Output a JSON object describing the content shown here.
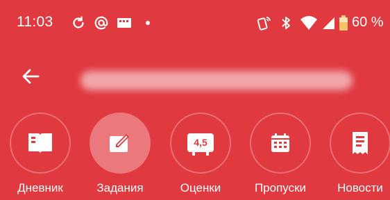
{
  "theme": {
    "accent": "#e0393f",
    "foreground": "#ffffff"
  },
  "status_bar": {
    "time": "11:03",
    "battery_percent": "60 %",
    "left_icons": [
      "sync-icon",
      "at-icon",
      "message-icon",
      "dot-icon"
    ],
    "right_icons": [
      "nfc-icon",
      "bluetooth-icon",
      "wifi-icon",
      "signal-icon",
      "battery-icon"
    ]
  },
  "toolbar": {
    "back_icon": "arrow-left-icon",
    "title": ""
  },
  "categories": [
    {
      "label": "Дневник",
      "icon": "book-icon",
      "active": false
    },
    {
      "label": "Задания",
      "icon": "edit-icon",
      "active": true
    },
    {
      "label": "Оценки",
      "icon": "grade-icon",
      "badge": "4,5",
      "active": false
    },
    {
      "label": "Пропуски",
      "icon": "calendar-icon",
      "active": false
    },
    {
      "label": "Новости",
      "icon": "news-icon",
      "active": false
    }
  ]
}
